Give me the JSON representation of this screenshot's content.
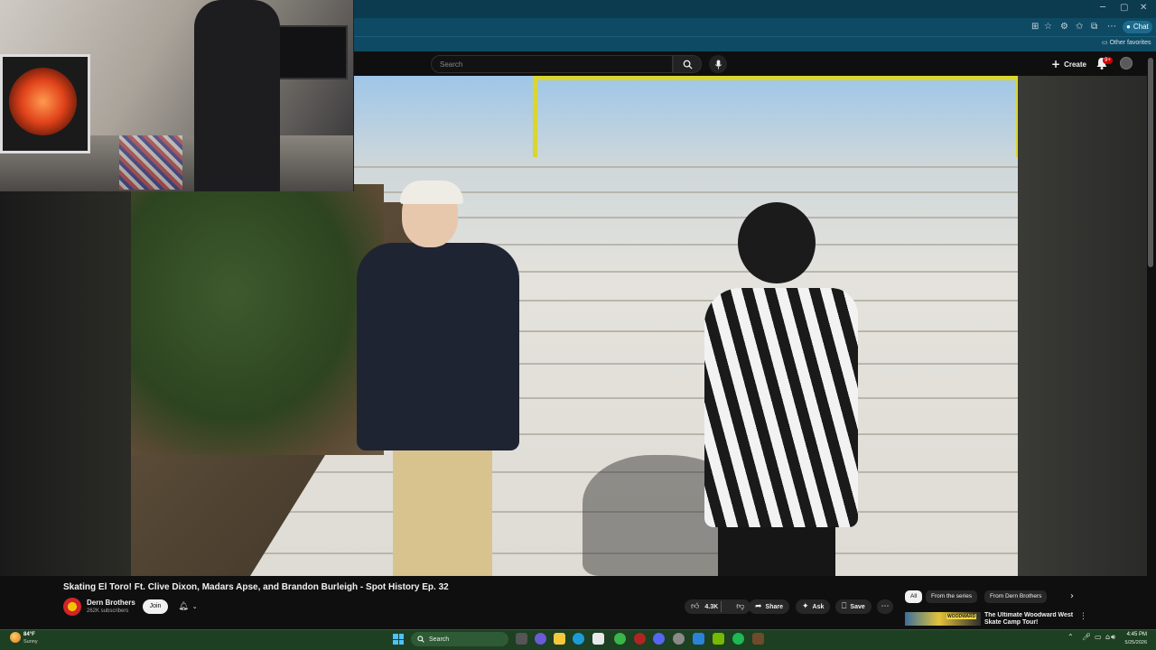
{
  "browser": {
    "other_favorites": "Other favorites",
    "copilot_label": "Chat",
    "window_controls": [
      "─",
      "▢",
      "✕"
    ]
  },
  "youtube": {
    "search_placeholder": "Search",
    "create_label": "Create",
    "notification_badge": "9+"
  },
  "video": {
    "title": "Skating El Toro! Ft. Clive Dixon, Madars Apse, and Brandon Burleigh - Spot History Ep. 32",
    "channel_name": "Dern Brothers",
    "subscribers": "262K subscribers",
    "join_label": "Join",
    "like_count": "4.3K",
    "share_label": "Share",
    "ask_label": "Ask",
    "save_label": "Save"
  },
  "sidebar": {
    "chips": [
      "All",
      "From the series",
      "From Dern Brothers"
    ],
    "recommendation": {
      "title": "The Ultimate Woodward West Skate Camp Tour!",
      "thumb_label": "WOODWARD"
    }
  },
  "taskbar": {
    "weather_temp": "84°F",
    "weather_condition": "Sunny",
    "search_label": "Search",
    "time": "4:45 PM",
    "date": "5/25/2026"
  },
  "colors": {
    "accent_blue": "#0e4a63",
    "youtube_bg": "#0f0f0f",
    "taskbar_green": "#1d3f22",
    "notif_red": "#cc0000"
  }
}
